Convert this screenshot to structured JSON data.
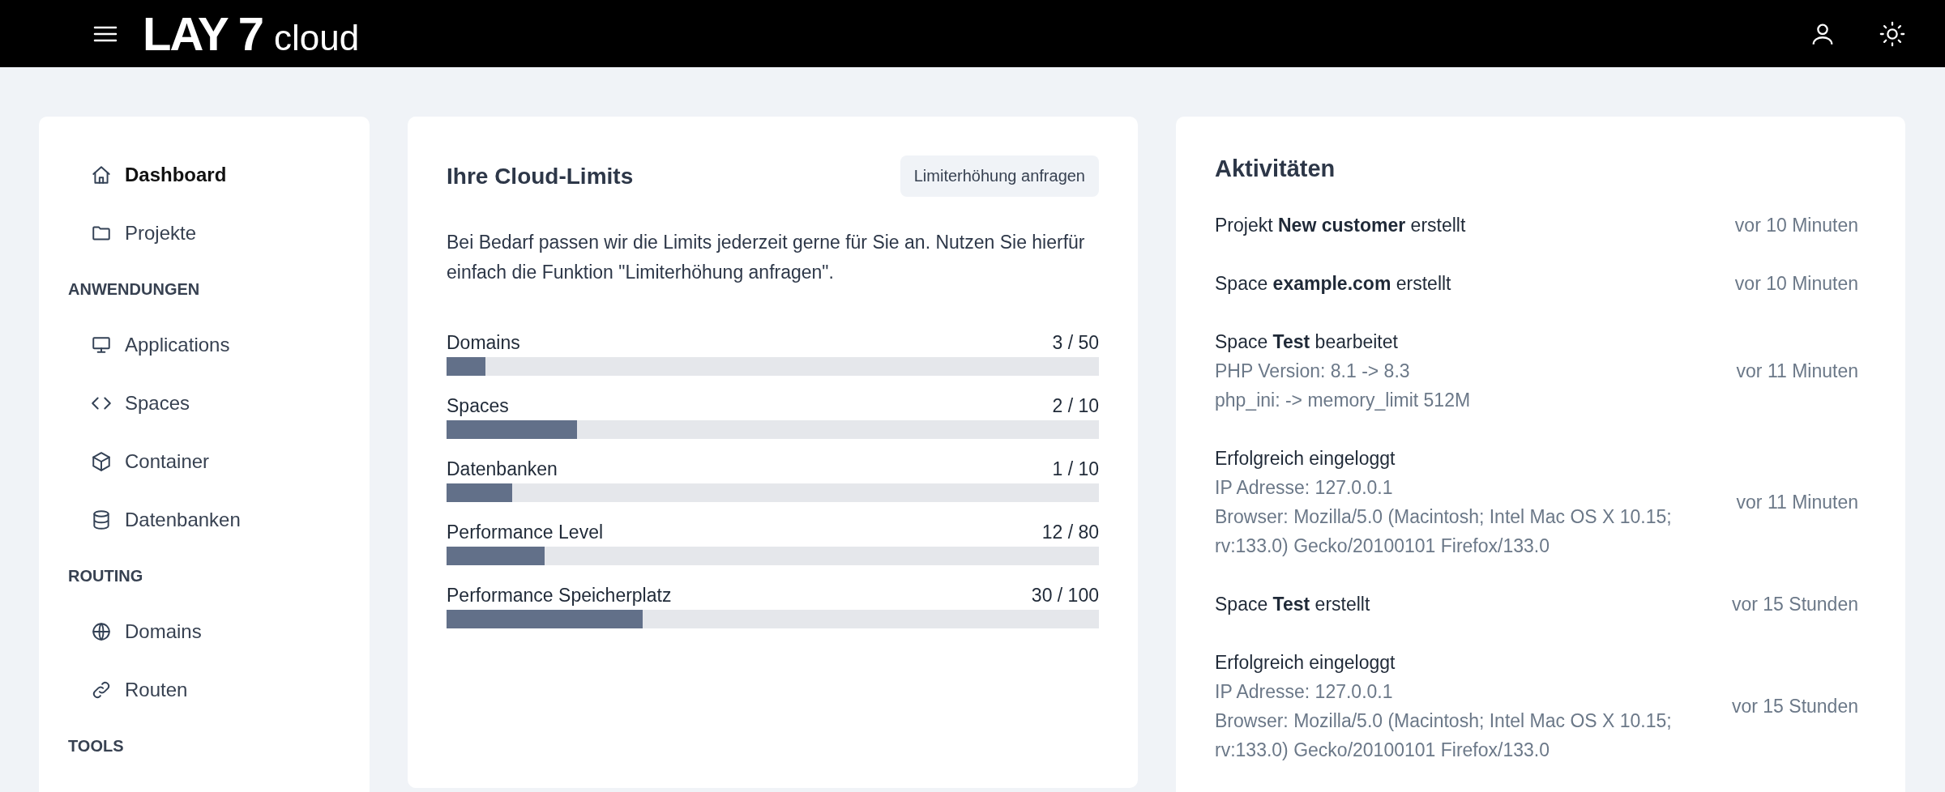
{
  "header": {
    "logo_main": "LAY 7",
    "logo_sub": "cloud"
  },
  "sidebar": {
    "items": [
      {
        "label": "Dashboard",
        "selected": true
      },
      {
        "label": "Projekte",
        "selected": false
      }
    ],
    "sections": [
      {
        "title": "ANWENDUNGEN",
        "items": [
          {
            "label": "Applications",
            "selected": false
          },
          {
            "label": "Spaces",
            "selected": false
          },
          {
            "label": "Container",
            "selected": false
          },
          {
            "label": "Datenbanken",
            "selected": false
          }
        ]
      },
      {
        "title": "ROUTING",
        "items": [
          {
            "label": "Domains",
            "selected": false
          },
          {
            "label": "Routen",
            "selected": false
          }
        ]
      },
      {
        "title": "TOOLS"
      }
    ]
  },
  "limits": {
    "title": "Ihre Cloud-Limits",
    "button": "Limiterhöhung anfragen",
    "description": "Bei Bedarf passen wir die Limits jederzeit gerne für Sie an. Nutzen Sie hierfür einfach die Funktion \"Limiterhöhung anfragen\".",
    "meters": [
      {
        "name": "Domains",
        "reading": "3 / 50",
        "level": 0.06
      },
      {
        "name": "Spaces",
        "reading": "2 / 10",
        "level": 0.2
      },
      {
        "name": "Datenbanken",
        "reading": "1 / 10",
        "level": 0.1
      },
      {
        "name": "Performance Level",
        "reading": "12 / 80",
        "level": 0.15
      },
      {
        "name": "Performance Speicherplatz",
        "reading": "30 / 100",
        "level": 0.3
      }
    ]
  },
  "activities": {
    "title": "Aktivitäten",
    "items": [
      {
        "text": "Projekt **New customer** erstellt",
        "time": "vor 10 Minuten"
      },
      {
        "text": "Space **example.com** erstellt",
        "time": "vor 10 Minuten"
      },
      {
        "text": "Space **Test** bearbeitet",
        "details": [
          "PHP Version: 8.1 -> 8.3",
          "php_ini: -> memory_limit 512M"
        ],
        "time": "vor 11 Minuten"
      },
      {
        "text": "Erfolgreich eingeloggt",
        "details": [
          "IP Adresse: 127.0.0.1",
          "Browser: Mozilla/5.0 (Macintosh; Intel Mac OS X 10.15; rv:133.0) Gecko/20100101 Firefox/133.0"
        ],
        "time": "vor 11 Minuten"
      },
      {
        "text": "Space **Test** erstellt",
        "time": "vor 15 Stunden"
      },
      {
        "text": "Erfolgreich eingeloggt",
        "details": [
          "IP Adresse: 127.0.0.1",
          "Browser: Mozilla/5.0 (Macintosh; Intel Mac OS X 10.15; rv:133.0) Gecko/20100101 Firefox/133.0"
        ],
        "time": "vor 15 Stunden"
      }
    ]
  }
}
